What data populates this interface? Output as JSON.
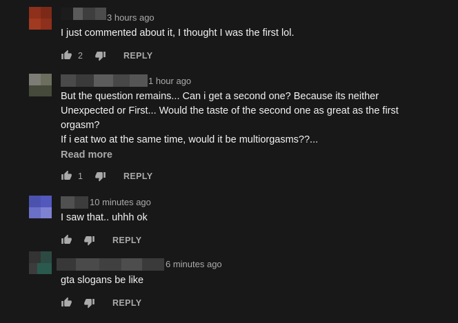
{
  "comments": [
    {
      "timestamp": "3 hours ago",
      "text": "I just commented about it, I thought I was the first lol.",
      "like_count": "2",
      "reply_label": "REPLY",
      "avatar_colors": [
        "#8a2f1a",
        "#a33a1f",
        "#7a2a16",
        "#933320"
      ]
    },
    {
      "timestamp": "1 hour ago",
      "text": "But the question remains... Can i get a second one? Because its neither\nUnexpected or First... Would the taste of the second one as great as the first\norgasm?\nIf i eat two at the same time, would it be multiorgasms??...",
      "read_more": "Read more",
      "like_count": "1",
      "reply_label": "REPLY",
      "avatar_colors": [
        "#7a7a72",
        "#5c5e4e",
        "#454a3c",
        "#6a6c5c"
      ]
    },
    {
      "timestamp": "10 minutes ago",
      "text": "I saw that.. uhhh ok",
      "like_count": "",
      "reply_label": "REPLY",
      "avatar_colors": [
        "#5a5ec0",
        "#4c54b0",
        "#8286d4",
        "#6a70c8"
      ]
    },
    {
      "timestamp": "6 minutes ago",
      "text": "gta slogans be like",
      "like_count": "",
      "reply_label": "REPLY",
      "avatar_colors": [
        "#3a3a3a",
        "#2c5a4e",
        "#404040",
        "#2a4c44"
      ]
    }
  ],
  "icons": {
    "like": "thumbs-up-icon",
    "dislike": "thumbs-down-icon"
  },
  "colors": {
    "background": "#181818",
    "text_primary": "#f1f1f1",
    "text_secondary": "#aaaaaa"
  }
}
